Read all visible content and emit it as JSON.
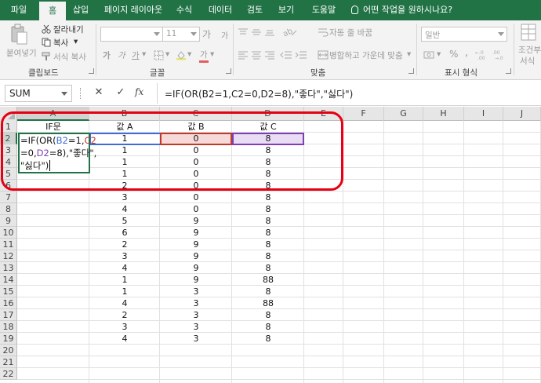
{
  "ribbon_tabs": [
    "파일",
    "홈",
    "삽입",
    "페이지 레이아웃",
    "수식",
    "데이터",
    "검토",
    "보기",
    "도움말"
  ],
  "active_tab": "홈",
  "tell_me": "어떤 작업을 원하시나요?",
  "clipboard": {
    "paste": "붙여넣기",
    "cut": "잘라내기",
    "copy": "복사",
    "format_painter": "서식 복사",
    "label": "클립보드"
  },
  "font": {
    "size": "11",
    "grow": "가",
    "shrink": "가",
    "bold": "가",
    "italic": "가",
    "underline": "가",
    "color_letter": "가",
    "label": "글꼴"
  },
  "alignment": {
    "wrap_text": "자동 줄 바꿈",
    "merge_center": "병합하고 가운데 맞춤",
    "label": "맞춤"
  },
  "number": {
    "format": "일반",
    "percent": "%",
    "comma": ",",
    "label": "표시 형식"
  },
  "styles": {
    "conditional_line1": "조건부",
    "conditional_line2": "서식"
  },
  "formula_bar": {
    "name_box": "SUM",
    "cancel": "✕",
    "enter": "✓",
    "fx": "fx",
    "formula": "=IF(OR(B2=1,C2=0,D2=8),\"좋다\",\"싫다\")"
  },
  "columns": [
    "A",
    "B",
    "C",
    "D",
    "E",
    "F",
    "G",
    "H",
    "I",
    "J"
  ],
  "rows": [
    "1",
    "2",
    "3",
    "4",
    "5",
    "6",
    "7",
    "8",
    "9",
    "10",
    "11",
    "12",
    "13",
    "14",
    "15",
    "16",
    "17",
    "18",
    "19",
    "20",
    "21",
    "22"
  ],
  "headers": {
    "A": "IF문",
    "B": "값 A",
    "C": "값 B",
    "D": "값 C"
  },
  "edit_cell": {
    "line1_a": "=IF(OR(",
    "line1_b": "B2",
    "line1_c": "=1,",
    "line1_d": "C2",
    "line2_a": "=0,",
    "line2_b": "D2",
    "line2_c": "=8),\"좋다\",",
    "line3": "\"싫다\")"
  },
  "table": {
    "B": [
      "1",
      "1",
      "1",
      "1",
      "2",
      "3",
      "4",
      "5",
      "6",
      "2",
      "3",
      "4",
      "1",
      "1",
      "4",
      "2",
      "3",
      "4"
    ],
    "C": [
      "0",
      "0",
      "0",
      "0",
      "0",
      "0",
      "0",
      "9",
      "9",
      "9",
      "9",
      "9",
      "9",
      "3",
      "3",
      "3",
      "3",
      "3"
    ],
    "D": [
      "8",
      "8",
      "8",
      "8",
      "8",
      "8",
      "8",
      "8",
      "8",
      "8",
      "8",
      "8",
      "88",
      "8",
      "88",
      "8",
      "8",
      "8"
    ]
  },
  "colors": {
    "excel_green": "#217346",
    "ref_b_blue": "#3d6dd8",
    "ref_c_red": "#c0392b",
    "ref_d_purple": "#7e3fb5",
    "annotation_red": "#e60012"
  }
}
